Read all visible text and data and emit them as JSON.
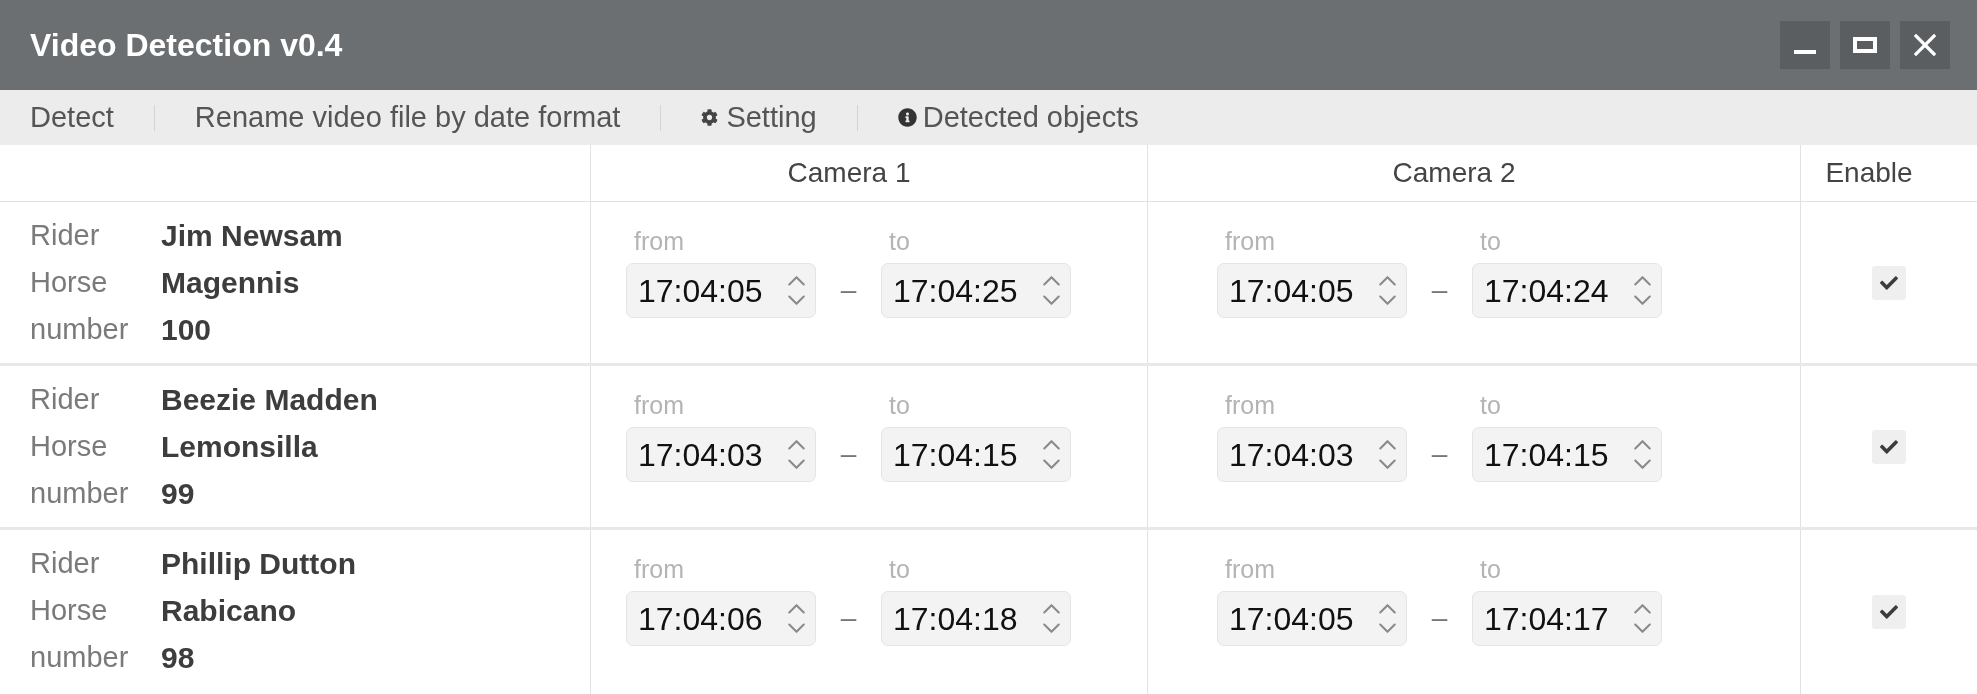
{
  "window": {
    "title": "Video Detection v0.4"
  },
  "menu": [
    {
      "label": "Detect",
      "kind": "plain"
    },
    {
      "label": "Rename video file by date format",
      "kind": "plain"
    },
    {
      "label": "Setting",
      "kind": "settings"
    },
    {
      "label": "Detected objects",
      "kind": "info"
    }
  ],
  "table": {
    "columns": [
      "Camera 1",
      "Camera 2",
      "Enable"
    ],
    "rows": [
      {
        "details": [
          {
            "label": "Rider",
            "value": "Jim Newsam"
          },
          {
            "label": "Horse",
            "value": "Magennis"
          },
          {
            "label": "number",
            "value": "100"
          }
        ],
        "cameras": [
          {
            "from_label": "from",
            "from": "17:04:05",
            "separator": "–",
            "to_label": "to",
            "to": "17:04:25"
          },
          {
            "from_label": "from",
            "from": "17:04:05",
            "separator": "–",
            "to_label": "to",
            "to": "17:04:24"
          }
        ],
        "enabled": true
      },
      {
        "details": [
          {
            "label": "Rider",
            "value": "Beezie Madden"
          },
          {
            "label": "Horse",
            "value": "Lemonsilla"
          },
          {
            "label": "number",
            "value": "99"
          }
        ],
        "cameras": [
          {
            "from_label": "from",
            "from": "17:04:03",
            "separator": "–",
            "to_label": "to",
            "to": "17:04:15"
          },
          {
            "from_label": "from",
            "from": "17:04:03",
            "separator": "–",
            "to_label": "to",
            "to": "17:04:15"
          }
        ],
        "enabled": true
      },
      {
        "details": [
          {
            "label": "Rider",
            "value": "Phillip Dutton"
          },
          {
            "label": "Horse",
            "value": "Rabicano"
          },
          {
            "label": "number",
            "value": "98"
          }
        ],
        "cameras": [
          {
            "from_label": "from",
            "from": "17:04:06",
            "separator": "–",
            "to_label": "to",
            "to": "17:04:18"
          },
          {
            "from_label": "from",
            "from": "17:04:05",
            "separator": "–",
            "to_label": "to",
            "to": "17:04:17"
          }
        ],
        "enabled": true
      }
    ]
  }
}
